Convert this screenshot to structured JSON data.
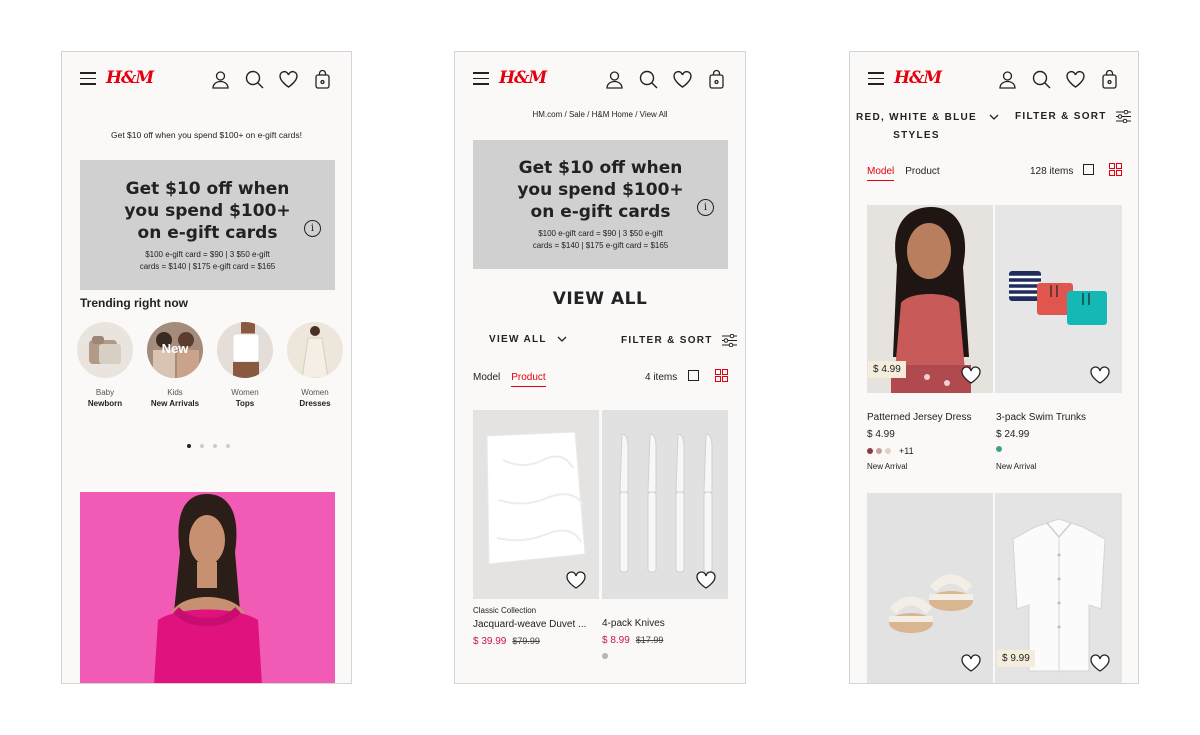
{
  "colors": {
    "brand": "#e50010",
    "sale_price": "#c41847",
    "promo_bg": "#d0d0d0",
    "page_bg": "#faf9f8",
    "price_tag_bg": "#f5eddb"
  },
  "header": {
    "logo": "H&M",
    "icons": [
      "menu-icon",
      "account-icon",
      "search-icon",
      "heart-icon",
      "bag-icon"
    ]
  },
  "screen1": {
    "promo_line": "Get $10 off when you spend $100+ on e-gift cards!",
    "promo": {
      "headline": [
        "Get $10 off when",
        "you spend $100+",
        "on e-gift cards"
      ],
      "details": [
        "$100 e-gift card = $90 | 3 $50 e-gift",
        "cards = $140 | $175 e-gift card = $165"
      ],
      "info_icon": "i"
    },
    "trending_title": "Trending right now",
    "trending": [
      {
        "line1": "Baby",
        "line2": "Newborn",
        "badge": ""
      },
      {
        "line1": "Kids",
        "line2": "New Arrivals",
        "badge": "New"
      },
      {
        "line1": "Women",
        "line2": "Tops",
        "badge": ""
      },
      {
        "line1": "Women",
        "line2": "Dresses",
        "badge": ""
      }
    ],
    "carousel_dots": 4,
    "carousel_active": 1
  },
  "screen2": {
    "breadcrumb": [
      "HM.com",
      "Sale",
      "H&M Home",
      "View All"
    ],
    "promo": {
      "headline": [
        "Get $10 off when",
        "you spend $100+",
        "on e-gift cards"
      ],
      "details": [
        "$100 e-gift card = $90 | 3 $50 e-gift",
        "cards = $140 | $175 e-gift card = $165"
      ],
      "info_icon": "i"
    },
    "page_title": "VIEW ALL",
    "category_select": "VIEW ALL",
    "filter_sort": "FILTER & SORT",
    "toggle": {
      "model": "Model",
      "product": "Product",
      "active": "product"
    },
    "items_count": "4 items",
    "products": [
      {
        "collection": "Classic Collection",
        "name": "Jacquard-weave Duvet ...",
        "price": "$ 39.99",
        "old_price": "$79.99"
      },
      {
        "collection": "",
        "name": "4-pack Knives",
        "price": "$ 8.99",
        "old_price": "$17.99"
      }
    ]
  },
  "screen3": {
    "category_select": [
      "RED, WHITE & BLUE",
      "STYLES"
    ],
    "filter_sort": "FILTER & SORT",
    "toggle": {
      "model": "Model",
      "product": "Product",
      "active": "model"
    },
    "items_count": "128 items",
    "products": [
      {
        "name": "Patterned Jersey Dress",
        "price": "$ 4.99",
        "badge_price": "$ 4.99",
        "swatch_more": "+11",
        "marker": "New Arrival",
        "swatches": [
          "#8a3c3c",
          "#c7a29a",
          "#e8cfc4"
        ]
      },
      {
        "name": "3-pack Swim Trunks",
        "price": "$ 24.99",
        "badge_price": "",
        "swatch_more": "",
        "marker": "New Arrival",
        "swatches": [
          "#3aa58a"
        ]
      },
      {
        "name": "",
        "price": "",
        "badge_price": "",
        "swatch_more": "",
        "marker": "",
        "swatches": []
      },
      {
        "name": "",
        "price": "",
        "badge_price": "$ 9.99",
        "swatch_more": "",
        "marker": "",
        "swatches": []
      }
    ]
  }
}
